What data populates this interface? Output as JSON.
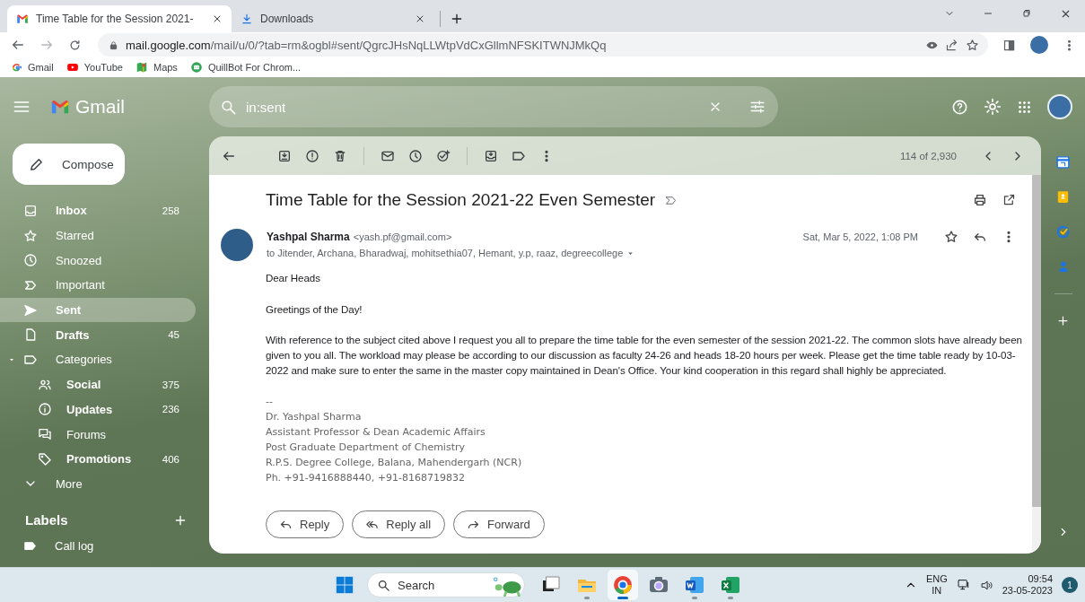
{
  "browser": {
    "tabs": [
      {
        "title": "Time Table for the Session 2021-",
        "selected": true
      },
      {
        "title": "Downloads",
        "selected": false
      }
    ],
    "url_host": "mail.google.com",
    "url_path": "/mail/u/0/?tab=rm&ogbl#sent/QgrcJHsNqLLWtpVdCxGllmNFSKITWNJMkQq",
    "bookmarks": [
      "Gmail",
      "YouTube",
      "Maps",
      "QuillBot For Chrom..."
    ]
  },
  "gmail": {
    "logo": "Gmail",
    "search": {
      "value": "in:sent"
    },
    "compose": "Compose",
    "nav": [
      {
        "label": "Inbox",
        "count": "258",
        "unread": true,
        "selected": false
      },
      {
        "label": "Starred",
        "unread": false,
        "selected": false
      },
      {
        "label": "Snoozed",
        "unread": false,
        "selected": false
      },
      {
        "label": "Important",
        "unread": false,
        "selected": false
      },
      {
        "label": "Sent",
        "unread": true,
        "selected": true
      },
      {
        "label": "Drafts",
        "count": "45",
        "unread": true,
        "selected": false
      },
      {
        "label": "Categories",
        "unread": false,
        "selected": false,
        "expanded": true,
        "children": [
          {
            "label": "Social",
            "count": "375",
            "unread": true,
            "selected": false
          },
          {
            "label": "Updates",
            "count": "236",
            "unread": true,
            "selected": false
          },
          {
            "label": "Forums",
            "unread": false,
            "selected": false
          },
          {
            "label": "Promotions",
            "count": "406",
            "unread": true,
            "selected": false
          }
        ]
      },
      {
        "label": "More",
        "unread": false,
        "selected": false
      }
    ],
    "labels_heading": "Labels",
    "labels": [
      {
        "name": "Call log"
      }
    ]
  },
  "message": {
    "counter": "114 of 2,930",
    "subject": "Time Table for the Session 2021-22 Even Semester",
    "sender": {
      "name": "Yashpal Sharma",
      "email": "<yash.pf@gmail.com>"
    },
    "recipients": "to Jitender, Archana, Bharadwaj, mohitsethia07, Hemant, y.p, raaz, degreecollege",
    "date": "Sat, Mar 5, 2022, 1:08 PM",
    "starred": false,
    "body": [
      "Dear Heads",
      "Greetings of the Day!",
      "With reference to the subject cited above I request you all to prepare the time table for the even semester of the session 2021-22. The common slots have already been given to you all. The workload may please be according to our discussion as faculty 24-26 and heads 18-20 hours per week. Please get the time table ready by 10-03-2022 and make sure to enter the same in the master copy maintained in Dean's Office. Your kind cooperation in this regard shall highly be appreciated."
    ],
    "signature": [
      "--",
      "Dr. Yashpal Sharma",
      "Assistant Professor & Dean Academic Affairs",
      "Post Graduate Department of Chemistry",
      "R.P.S. Degree College, Balana, Mahendergarh (NCR)",
      "Ph. +91-9416888440, +91-8168719832"
    ],
    "actions": [
      "Reply",
      "Reply all",
      "Forward"
    ]
  },
  "taskbar": {
    "search_placeholder": "Search",
    "apps": [
      {
        "running": false,
        "selected": false
      },
      {
        "running": true,
        "selected": false
      },
      {
        "running": true,
        "selected": true
      },
      {
        "running": false,
        "selected": false
      },
      {
        "running": true,
        "selected": false
      },
      {
        "running": true,
        "selected": false
      }
    ],
    "language": [
      "ENG",
      "IN"
    ],
    "time": "09:54",
    "date": "23-05-2023",
    "notifications": "1"
  }
}
